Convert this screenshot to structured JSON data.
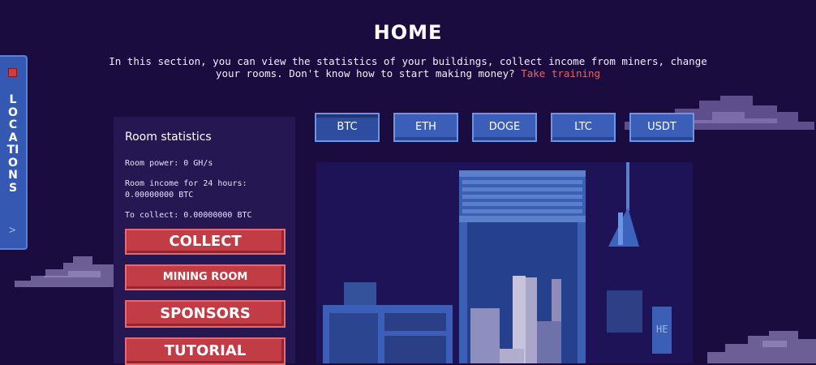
{
  "page": {
    "title": "HOME",
    "intro_text": "In this section, you can view the statistics of your buildings, collect income from miners, change your rooms. Don't know how to start making money?",
    "training_link": "Take training"
  },
  "side_tab": {
    "label": "LOCATIONS"
  },
  "room_statistics": {
    "title": "Room statistics",
    "power": "Room power: 0 GH/s",
    "income_label": "Room income for 24 hours:",
    "income_value": "0.00000000 BTC",
    "to_collect": "To collect: 0.00000000 BTC"
  },
  "actions": {
    "collect": "COLLECT",
    "mining_room": "MINING ROOM",
    "sponsors": "SPONSORS",
    "tutorial": "TUTORIAL"
  },
  "coin_tabs": [
    "BTC",
    "ETH",
    "DOGE",
    "LTC",
    "USDT"
  ],
  "selected_coin": "BTC",
  "colors": {
    "background": "#1b0c3f",
    "panel": "#241752",
    "button_red": "#c23c46",
    "tab_blue": "#3b5fb8",
    "link": "#e2636b"
  }
}
